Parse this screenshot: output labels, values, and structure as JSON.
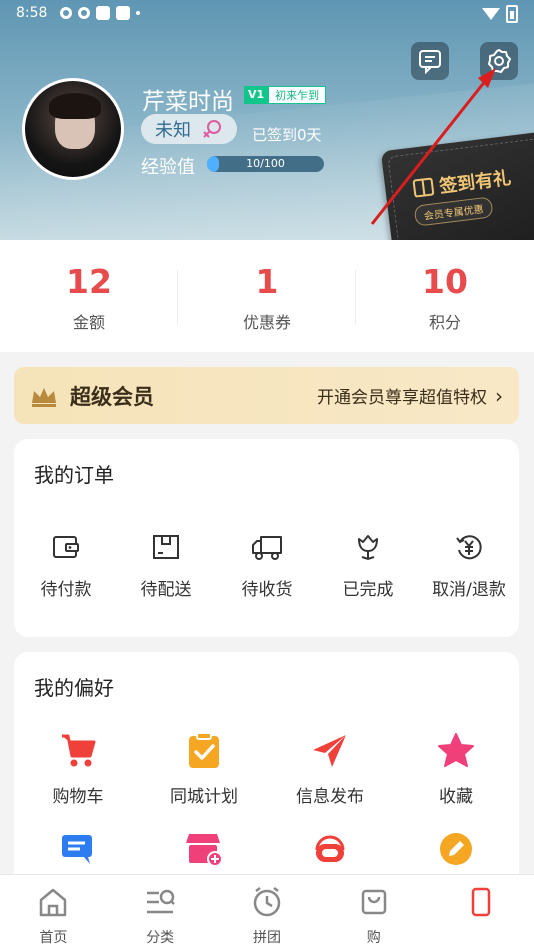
{
  "status_bar": {
    "time": "8:58"
  },
  "profile": {
    "nickname": "芹菜时尚",
    "vip_level": "V1",
    "vip_tag": "初来乍到",
    "gender": "未知",
    "signed_days": "已签到0天",
    "exp_label": "经验值",
    "exp_text": "10/100",
    "exp_progress": 0.1
  },
  "sign_card": {
    "title": "签到有礼",
    "subtitle": "会员专属优惠"
  },
  "stats": [
    {
      "value": "12",
      "label": "金额"
    },
    {
      "value": "1",
      "label": "优惠券"
    },
    {
      "value": "10",
      "label": "积分"
    }
  ],
  "vip_banner": {
    "title": "超级会员",
    "promo": "开通会员尊享超值特权",
    "chevron": "›"
  },
  "orders": {
    "title": "我的订单",
    "items": [
      {
        "label": "待付款",
        "icon": "wallet-icon"
      },
      {
        "label": "待配送",
        "icon": "box-icon"
      },
      {
        "label": "待收货",
        "icon": "truck-icon"
      },
      {
        "label": "已完成",
        "icon": "flower-icon"
      },
      {
        "label": "取消/退款",
        "icon": "refund-icon"
      }
    ]
  },
  "preferences": {
    "title": "我的偏好",
    "items": [
      {
        "label": "购物车",
        "icon": "cart-icon",
        "color": "#f0403a"
      },
      {
        "label": "同城计划",
        "icon": "clipboard-check-icon",
        "color": "#f5a623"
      },
      {
        "label": "信息发布",
        "icon": "paper-plane-icon",
        "color": "#f0403a"
      },
      {
        "label": "收藏",
        "icon": "star-icon",
        "color": "#f0407a"
      },
      {
        "label": "",
        "icon": "chat-icon",
        "color": "#2d7cf0"
      },
      {
        "label": "",
        "icon": "store-add-icon",
        "color": "#f0407a"
      },
      {
        "label": "",
        "icon": "headset-icon",
        "color": "#f0403a"
      },
      {
        "label": "",
        "icon": "edit-icon",
        "color": "#f5a623"
      }
    ]
  },
  "tabbar": [
    {
      "label": "首页",
      "icon": "home-icon"
    },
    {
      "label": "分类",
      "icon": "category-icon"
    },
    {
      "label": "拼团",
      "icon": "clock-icon"
    },
    {
      "label": "购",
      "icon": "cart-tab-icon"
    },
    {
      "label": "",
      "icon": "profile-tab-icon"
    }
  ]
}
